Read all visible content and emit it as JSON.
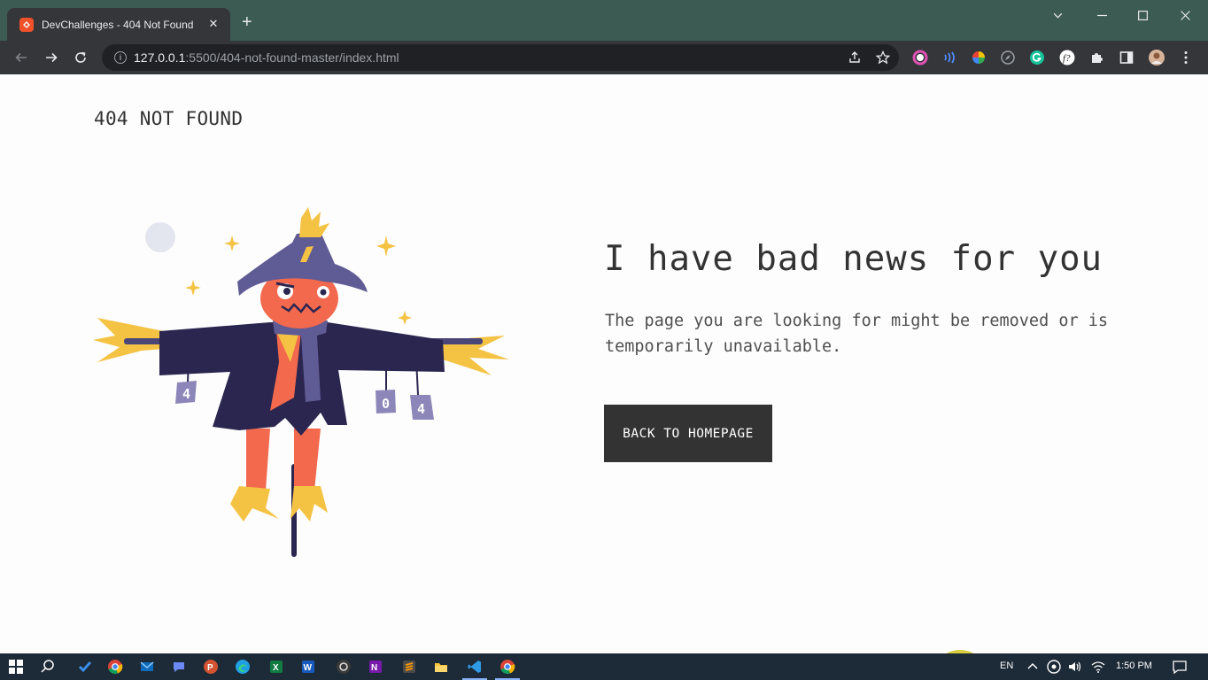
{
  "browser": {
    "tab_title": "DevChallenges - 404 Not Found",
    "tab_close": "✕",
    "new_tab": "+",
    "url_host": "127.0.0.1",
    "url_rest": ":5500/404-not-found-master/index.html"
  },
  "page": {
    "logo": "404 NOT FOUND",
    "headline": "I have bad news for you",
    "message": "The page you are looking for might be removed or is temporarily unavailable.",
    "button_label": "BACK TO HOMEPAGE",
    "sign_digits": [
      "4",
      "0",
      "4"
    ]
  },
  "taskbar": {
    "language": "EN",
    "time": "1:50 PM"
  },
  "colors": {
    "tab_strip": "#3c5b53",
    "button_bg": "#333333",
    "hat": "#5f5b94",
    "coat": "#2b2650",
    "face": "#f2694e",
    "straw": "#f5c344"
  }
}
